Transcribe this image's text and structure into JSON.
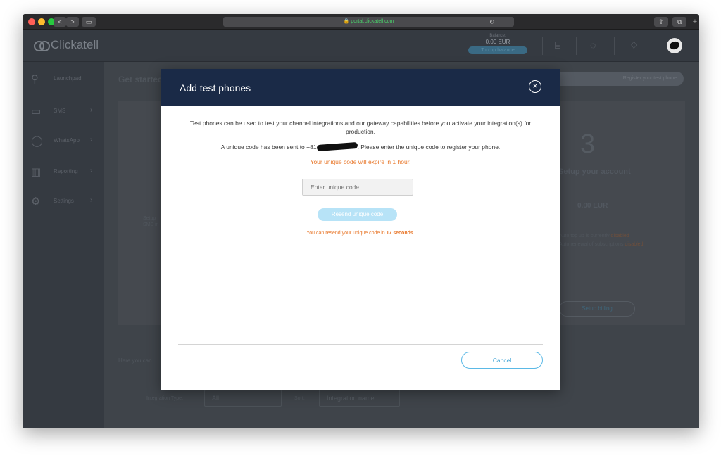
{
  "browser": {
    "address": "portal.clickatell.com",
    "nav_back": "<",
    "nav_forward": ">",
    "reload_glyph": "↻",
    "plus_glyph": "+"
  },
  "header": {
    "logo_text": "Clickatell",
    "balance_label": "Balance:",
    "balance_value": "0.00 EUR",
    "topup_label": "Top up balance"
  },
  "sidebar": {
    "items": [
      {
        "label": "Launchpad",
        "icon": "rocket-icon"
      },
      {
        "label": "SMS",
        "icon": "sms-icon"
      },
      {
        "label": "WhatsApp",
        "icon": "whatsapp-icon"
      },
      {
        "label": "Reporting",
        "icon": "chart-icon"
      },
      {
        "label": "Settings",
        "icon": "gear-icon"
      }
    ]
  },
  "main": {
    "title": "Get started",
    "register_label": "Register your test phone",
    "step_number": "3",
    "step_title": "Setup your account",
    "step_amount": "0.00 EUR",
    "step_line1": "Auto top up is currently",
    "step_line2": "Auto renewal of subscriptions",
    "disabled_word": "disabled",
    "setup_billing": "Setup billing",
    "left_text_1": "Setup",
    "left_text_2": "SMS in",
    "here_text": "Here you can",
    "integration_type_label": "Integration Type:",
    "integration_type_value": "All",
    "sort_label": "Sort:",
    "sort_value": "Integration name",
    "up_button": "^"
  },
  "modal": {
    "title": "Add test phones",
    "close_glyph": "×",
    "intro": "Test phones can be used to test your channel integrations and our gateway capabilities before you activate your integration(s) for production.",
    "sent_prefix": "A unique code has been sent to +81",
    "sent_suffix": ". Please enter the unique code to register your phone.",
    "expire_text": "Your unique code will expire in 1 hour.",
    "code_placeholder": "Enter unique code",
    "resend_label": "Resend unique code",
    "countdown_prefix": "You can resend your unique code in ",
    "countdown_value": "17 seconds",
    "countdown_suffix": ".",
    "cancel_label": "Cancel"
  }
}
